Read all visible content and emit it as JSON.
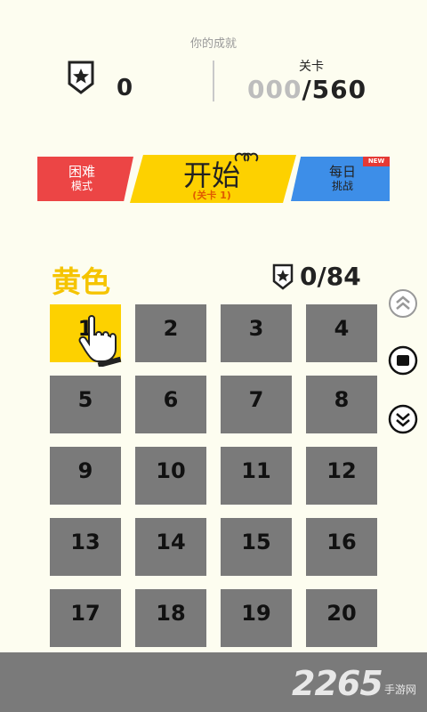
{
  "header": {
    "achievement_label": "你的成就",
    "badge_count": "0",
    "level_label": "关卡",
    "level_done_zeros": "000",
    "level_total": "/560"
  },
  "modes": {
    "hard": {
      "line1": "困难",
      "line2": "模式"
    },
    "start": {
      "label": "开始",
      "sub": "(关卡 1)"
    },
    "daily": {
      "line1": "每日",
      "line2": "挑战",
      "badge": "NEW"
    }
  },
  "section": {
    "color_name": "黄色",
    "progress": "0/84"
  },
  "levels": [
    "1",
    "2",
    "3",
    "4",
    "5",
    "6",
    "7",
    "8",
    "9",
    "10",
    "11",
    "12",
    "13",
    "14",
    "15",
    "16",
    "17",
    "18",
    "19",
    "20"
  ],
  "active_level": "1",
  "watermark": {
    "main": "2265",
    "sub": "手游网"
  },
  "colors": {
    "yellow": "#fdd100",
    "red": "#ec4545",
    "blue": "#3d8ee8",
    "gray": "#7a7a7a"
  }
}
